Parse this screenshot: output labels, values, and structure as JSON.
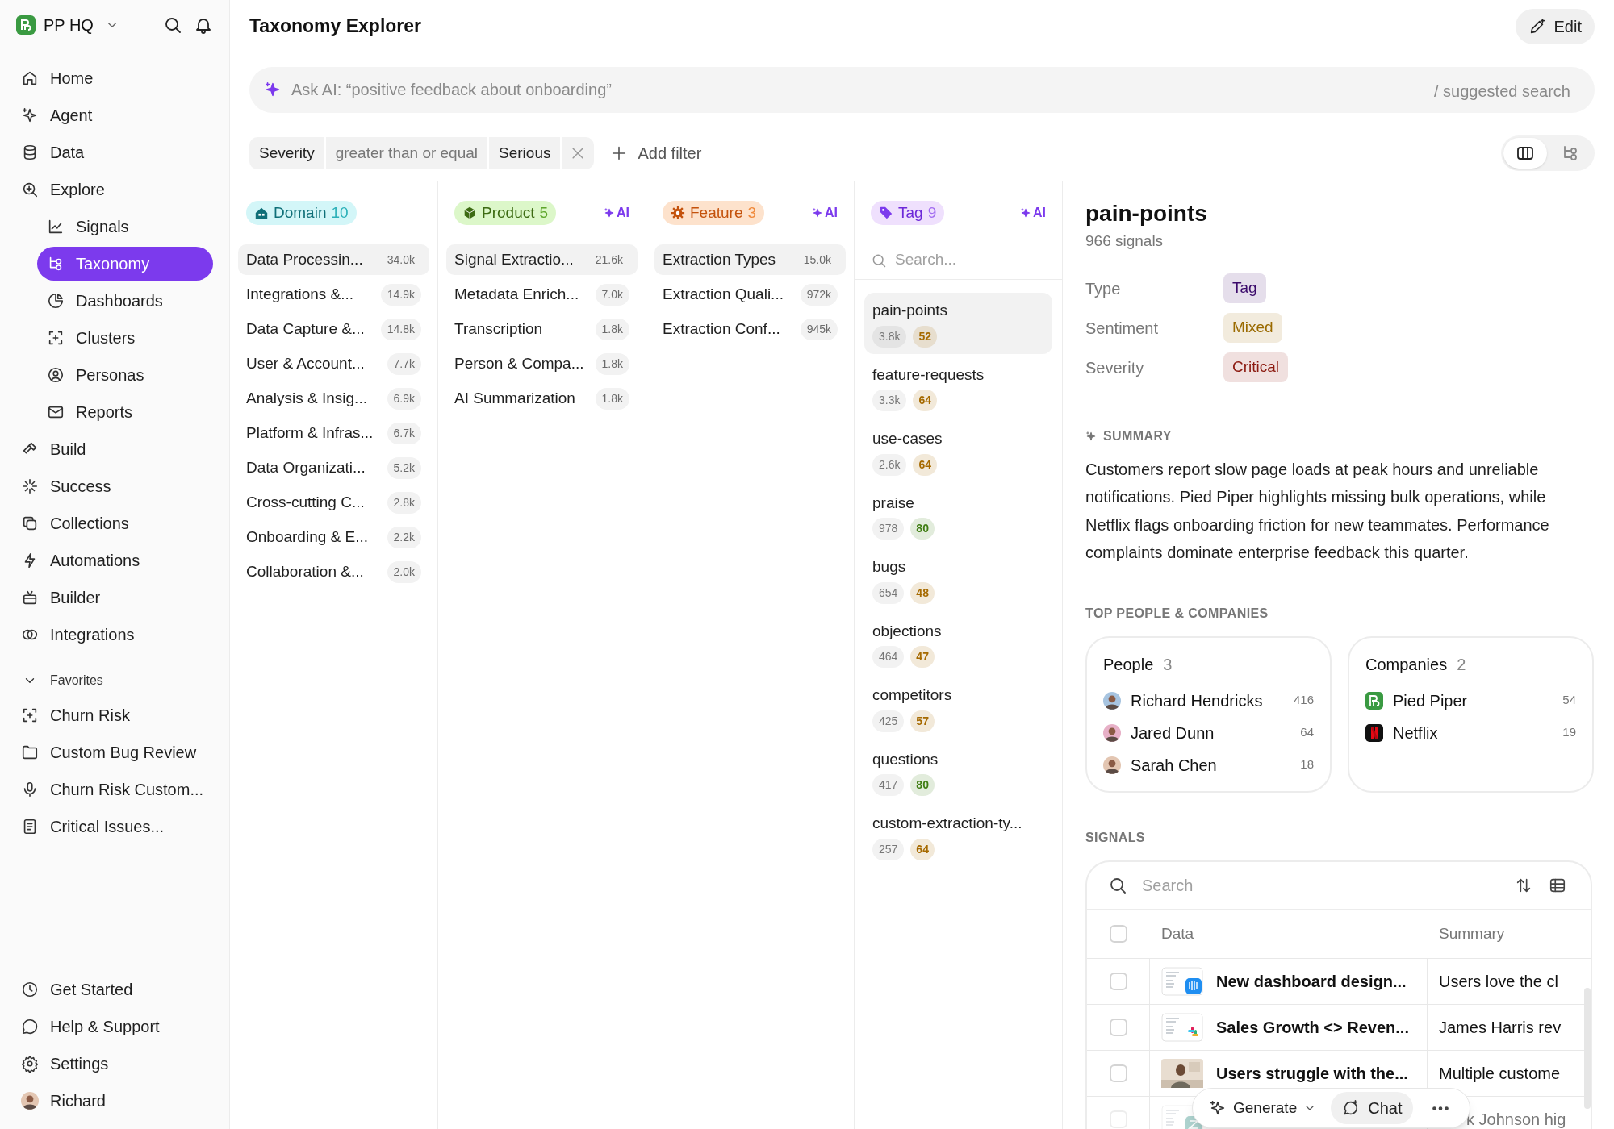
{
  "sidebar": {
    "workspace": "PP HQ",
    "nav": [
      {
        "label": "Home",
        "selected": false
      },
      {
        "label": "Agent",
        "selected": false
      },
      {
        "label": "Data",
        "selected": false
      },
      {
        "label": "Explore",
        "selected": false,
        "children": [
          {
            "label": "Signals",
            "selected": false
          },
          {
            "label": "Taxonomy",
            "selected": true
          },
          {
            "label": "Dashboards",
            "selected": false
          },
          {
            "label": "Clusters",
            "selected": false
          },
          {
            "label": "Personas",
            "selected": false
          },
          {
            "label": "Reports",
            "selected": false
          }
        ]
      },
      {
        "label": "Build",
        "selected": false
      },
      {
        "label": "Success",
        "selected": false
      },
      {
        "label": "Collections",
        "selected": false
      },
      {
        "label": "Automations",
        "selected": false
      },
      {
        "label": "Builder",
        "selected": false
      },
      {
        "label": "Integrations",
        "selected": false
      }
    ],
    "favorites_label": "Favorites",
    "favorites_expanded": true,
    "favorites": [
      {
        "label": "Churn Risk",
        "selected": false
      },
      {
        "label": "Custom Bug Review",
        "selected": false
      },
      {
        "label": "Churn Risk Custom...",
        "selected": false
      },
      {
        "label": "Critical Issues...",
        "selected": false
      }
    ],
    "footer": [
      {
        "label": "Get Started",
        "selected": false
      },
      {
        "label": "Help & Support",
        "selected": false
      },
      {
        "label": "Settings",
        "selected": false
      },
      {
        "label": "Richard",
        "selected": false
      }
    ]
  },
  "header": {
    "title": "Taxonomy Explorer",
    "edit_button": "Edit"
  },
  "ask_ai": {
    "placeholder": "Ask AI: “positive feedback about onboarding”",
    "hint": "/ suggested search"
  },
  "filter": {
    "field": "Severity",
    "operator": "greater than or equal",
    "value": "Serious"
  },
  "add_filter": "Add filter",
  "view_toggle": [
    {
      "kind": "columns",
      "selected": true
    },
    {
      "kind": "tree",
      "selected": false
    }
  ],
  "columns": [
    {
      "kind": "domain",
      "label": "Domain",
      "count": "10",
      "items": [
        {
          "label": "Data Processin...",
          "count": "34.0k",
          "selected": true
        },
        {
          "label": "Integrations &...",
          "count": "14.9k",
          "selected": false
        },
        {
          "label": "Data Capture &...",
          "count": "14.8k",
          "selected": false
        },
        {
          "label": "User & Account...",
          "count": "7.7k",
          "selected": false
        },
        {
          "label": "Analysis & Insig...",
          "count": "6.9k",
          "selected": false
        },
        {
          "label": "Platform & Infras...",
          "count": "6.7k",
          "selected": false
        },
        {
          "label": "Data Organizati...",
          "count": "5.2k",
          "selected": false
        },
        {
          "label": "Cross-cutting C...",
          "count": "2.8k",
          "selected": false
        },
        {
          "label": "Onboarding & E...",
          "count": "2.2k",
          "selected": false
        },
        {
          "label": "Collaboration &...",
          "count": "2.0k",
          "selected": false
        }
      ]
    },
    {
      "kind": "product",
      "label": "Product",
      "count": "5",
      "ai_label": "AI",
      "items": [
        {
          "label": "Signal Extractio...",
          "count": "21.6k",
          "selected": true
        },
        {
          "label": "Metadata Enrich...",
          "count": "7.0k",
          "selected": false
        },
        {
          "label": "Transcription",
          "count": "1.8k",
          "selected": false
        },
        {
          "label": "Person & Compa...",
          "count": "1.8k",
          "selected": false
        },
        {
          "label": "AI Summarization",
          "count": "1.8k",
          "selected": false
        }
      ]
    },
    {
      "kind": "feature",
      "label": "Feature",
      "count": "3",
      "ai_label": "AI",
      "items": [
        {
          "label": "Extraction Types",
          "count": "15.0k",
          "selected": true
        },
        {
          "label": "Extraction Quali...",
          "count": "972k",
          "selected": false
        },
        {
          "label": "Extraction Conf...",
          "count": "945k",
          "selected": false
        }
      ]
    }
  ],
  "tag_column": {
    "label": "Tag",
    "count": "9",
    "ai_label": "AI",
    "search_placeholder": "Search...",
    "items": [
      {
        "name": "pain-points",
        "count": "3.8k",
        "score": "52",
        "color": "#a66a00",
        "selected": true
      },
      {
        "name": "feature-requests",
        "count": "3.3k",
        "score": "64",
        "color": "#a66a00",
        "selected": false
      },
      {
        "name": "use-cases",
        "count": "2.6k",
        "score": "64",
        "color": "#a66a00",
        "selected": false
      },
      {
        "name": "praise",
        "count": "978",
        "score": "80",
        "color": "#3f7d12",
        "selected": false
      },
      {
        "name": "bugs",
        "count": "654",
        "score": "48",
        "color": "#a66a00",
        "selected": false
      },
      {
        "name": "objections",
        "count": "464",
        "score": "47",
        "color": "#a66a00",
        "selected": false
      },
      {
        "name": "competitors",
        "count": "425",
        "score": "57",
        "color": "#a66a00",
        "selected": false
      },
      {
        "name": "questions",
        "count": "417",
        "score": "80",
        "color": "#3f7d12",
        "selected": false
      },
      {
        "name": "custom-extraction-ty...",
        "count": "257",
        "score": "64",
        "color": "#a66a00",
        "selected": false
      }
    ]
  },
  "detail": {
    "title": "pain-points",
    "subtitle": "966 signals",
    "properties": [
      {
        "label": "Type",
        "value": "Tag",
        "color": "#3b0a6b"
      },
      {
        "label": "Sentiment",
        "value": "Mixed",
        "color": "#9a6a00"
      },
      {
        "label": "Severity",
        "value": "Critical",
        "color": "#8c1a10"
      }
    ],
    "summary_label": "SUMMARY",
    "summary": "Customers report slow page loads at peak hours and unreliable notifications. Pied Piper highlights missing bulk operations, while Netflix flags onboarding friction for new teammates. Performance complaints dominate enterprise feedback this quarter.",
    "top_label": "TOP PEOPLE & COMPANIES",
    "people": {
      "label": "People",
      "count": "3",
      "items": [
        {
          "name": "Richard Hendricks",
          "count": "416"
        },
        {
          "name": "Jared Dunn",
          "count": "64"
        },
        {
          "name": "Sarah Chen",
          "count": "18"
        }
      ]
    },
    "companies": {
      "label": "Companies",
      "count": "2",
      "items": [
        {
          "name": "Pied Piper",
          "count": "54",
          "color": "#3a9a42"
        },
        {
          "name": "Netflix",
          "count": "19",
          "color": "#111111"
        }
      ]
    },
    "signals_label": "SIGNALS",
    "signals": {
      "search_placeholder": "Search",
      "columns": [
        "Data",
        "Summary"
      ],
      "header_checked": false,
      "rows": [
        {
          "kind": "document",
          "title": "New dashboard design...",
          "summary": "Users love the cl",
          "checked": false
        },
        {
          "kind": "document",
          "title": "Sales Growth <> Reven...",
          "summary": "James Harris rev",
          "checked": false
        },
        {
          "kind": "video",
          "title": "Users struggle with the...",
          "summary": "Multiple custome",
          "checked": false
        },
        {
          "kind": "document",
          "summary": "k Johnson hig",
          "checked": false
        }
      ]
    }
  },
  "toolbar": {
    "generate": "Generate",
    "chat": "Chat"
  }
}
